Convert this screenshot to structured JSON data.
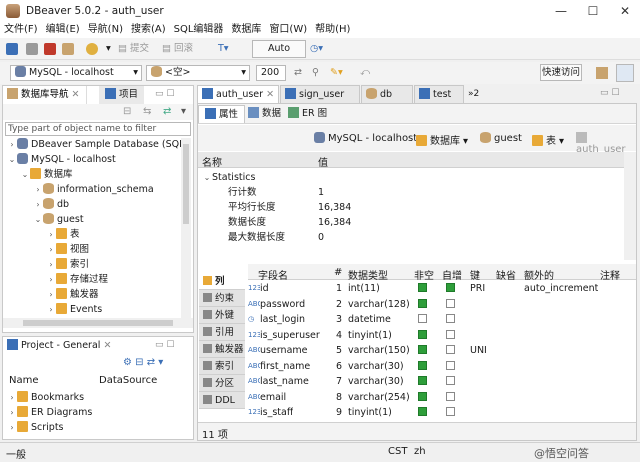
{
  "window": {
    "title": "DBeaver 5.0.2 - auth_user",
    "min": "—",
    "max": "☐",
    "close": "✕"
  },
  "menu": [
    "文件(F)",
    "编辑(E)",
    "导航(N)",
    "搜索(A)",
    "SQL编辑器",
    "数据库",
    "窗口(W)",
    "帮助(H)"
  ],
  "toolbar": {
    "commit": "提交",
    "rollback": "回滚",
    "mode": "Auto"
  },
  "toolbar2": {
    "connection": "MySQL - localhost",
    "schema": "<空>",
    "limit": "200",
    "quick_access": "快速访问"
  },
  "navigator": {
    "tab1": "数据库导航",
    "tab2": "项目",
    "filter_placeholder": "Type part of object name to filter",
    "tree": [
      {
        "label": "DBeaver Sample Database (SQLit",
        "indent": 0,
        "icon": "dolphin",
        "tw": "›"
      },
      {
        "label": "MySQL - localhost",
        "indent": 0,
        "icon": "dolphin",
        "tw": "⌄"
      },
      {
        "label": "数据库",
        "indent": 1,
        "icon": "folder",
        "tw": "⌄"
      },
      {
        "label": "information_schema",
        "indent": 2,
        "icon": "db",
        "tw": "›"
      },
      {
        "label": "db",
        "indent": 2,
        "icon": "db",
        "tw": "›"
      },
      {
        "label": "guest",
        "indent": 2,
        "icon": "db",
        "tw": "⌄"
      },
      {
        "label": "表",
        "indent": 3,
        "icon": "folder",
        "tw": "›"
      },
      {
        "label": "视图",
        "indent": 3,
        "icon": "folder",
        "tw": "›"
      },
      {
        "label": "索引",
        "indent": 3,
        "icon": "folder",
        "tw": "›"
      },
      {
        "label": "存储过程",
        "indent": 3,
        "icon": "folder",
        "tw": "›"
      },
      {
        "label": "触发器",
        "indent": 3,
        "icon": "folder",
        "tw": "›"
      },
      {
        "label": "Events",
        "indent": 3,
        "icon": "folder",
        "tw": "›"
      }
    ]
  },
  "project": {
    "title": "Project - General",
    "col_name": "Name",
    "col_ds": "DataSource",
    "items": [
      "Bookmarks",
      "ER Diagrams",
      "Scripts"
    ]
  },
  "editor_tabs": [
    "auth_user",
    "sign_user",
    "db",
    "test"
  ],
  "editor_tabs_more": "»2",
  "subtabs": [
    "属性",
    "数据",
    "ER 图"
  ],
  "breadcrumb": {
    "connection": "MySQL - localhost",
    "catalog": "数据库",
    "schema": "guest",
    "type": "表",
    "object": "auth_user"
  },
  "props": {
    "col_name": "名称",
    "col_value": "值",
    "group": "Statistics",
    "rows": [
      {
        "name": "行计数",
        "value": "1"
      },
      {
        "name": "平均行长度",
        "value": "16,384"
      },
      {
        "name": "数据长度",
        "value": "16,384"
      },
      {
        "name": "最大数据长度",
        "value": "0"
      }
    ]
  },
  "side_tabs": [
    "列",
    "约束",
    "外键",
    "引用",
    "触发器",
    "索引",
    "分区",
    "DDL"
  ],
  "columns": {
    "headers": [
      "字段名",
      "#",
      "数据类型",
      "非空",
      "自增",
      "键",
      "缺省",
      "额外的",
      "注释"
    ],
    "rows": [
      {
        "name": "id",
        "type_icon": "123",
        "num": "1",
        "dtype": "int(11)",
        "notnull": true,
        "autoinc": true,
        "key": "PRI",
        "default": "",
        "extra": "auto_increment"
      },
      {
        "name": "password",
        "type_icon": "ABC",
        "num": "2",
        "dtype": "varchar(128)",
        "notnull": true,
        "autoinc": false,
        "key": "",
        "default": "",
        "extra": ""
      },
      {
        "name": "last_login",
        "type_icon": "clock",
        "num": "3",
        "dtype": "datetime",
        "notnull": false,
        "autoinc": false,
        "key": "",
        "default": "",
        "extra": ""
      },
      {
        "name": "is_superuser",
        "type_icon": "123",
        "num": "4",
        "dtype": "tinyint(1)",
        "notnull": true,
        "autoinc": false,
        "key": "",
        "default": "",
        "extra": ""
      },
      {
        "name": "username",
        "type_icon": "ABC",
        "num": "5",
        "dtype": "varchar(150)",
        "notnull": true,
        "autoinc": false,
        "key": "UNI",
        "default": "",
        "extra": ""
      },
      {
        "name": "first_name",
        "type_icon": "ABC",
        "num": "6",
        "dtype": "varchar(30)",
        "notnull": true,
        "autoinc": false,
        "key": "",
        "default": "",
        "extra": ""
      },
      {
        "name": "last_name",
        "type_icon": "ABC",
        "num": "7",
        "dtype": "varchar(30)",
        "notnull": true,
        "autoinc": false,
        "key": "",
        "default": "",
        "extra": ""
      },
      {
        "name": "email",
        "type_icon": "ABC",
        "num": "8",
        "dtype": "varchar(254)",
        "notnull": true,
        "autoinc": false,
        "key": "",
        "default": "",
        "extra": ""
      },
      {
        "name": "is_staff",
        "type_icon": "123",
        "num": "9",
        "dtype": "tinyint(1)",
        "notnull": true,
        "autoinc": false,
        "key": "",
        "default": "",
        "extra": ""
      }
    ],
    "count": "11 项"
  },
  "status": {
    "left": "一般",
    "tz": "CST",
    "lang": "zh",
    "watermark": "@悟空问答"
  }
}
